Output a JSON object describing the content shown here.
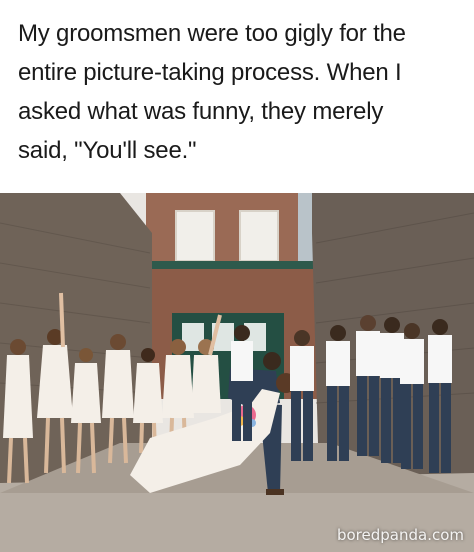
{
  "caption": {
    "lines": [
      "My groomsmen were too gigly for the",
      "entire picture-taking process. When I",
      "asked what was funny, they merely",
      "said, \"You'll see.\""
    ]
  },
  "watermark": "boredpanda.com",
  "colors": {
    "brick": "#8a5a45",
    "wall_stone": "#6e6257",
    "door": "#1f5c4a",
    "dress_white": "#f4efe8",
    "suit_navy": "#2f3f55",
    "shirt_white": "#f7f7f7",
    "ground": "#b7aea4"
  }
}
